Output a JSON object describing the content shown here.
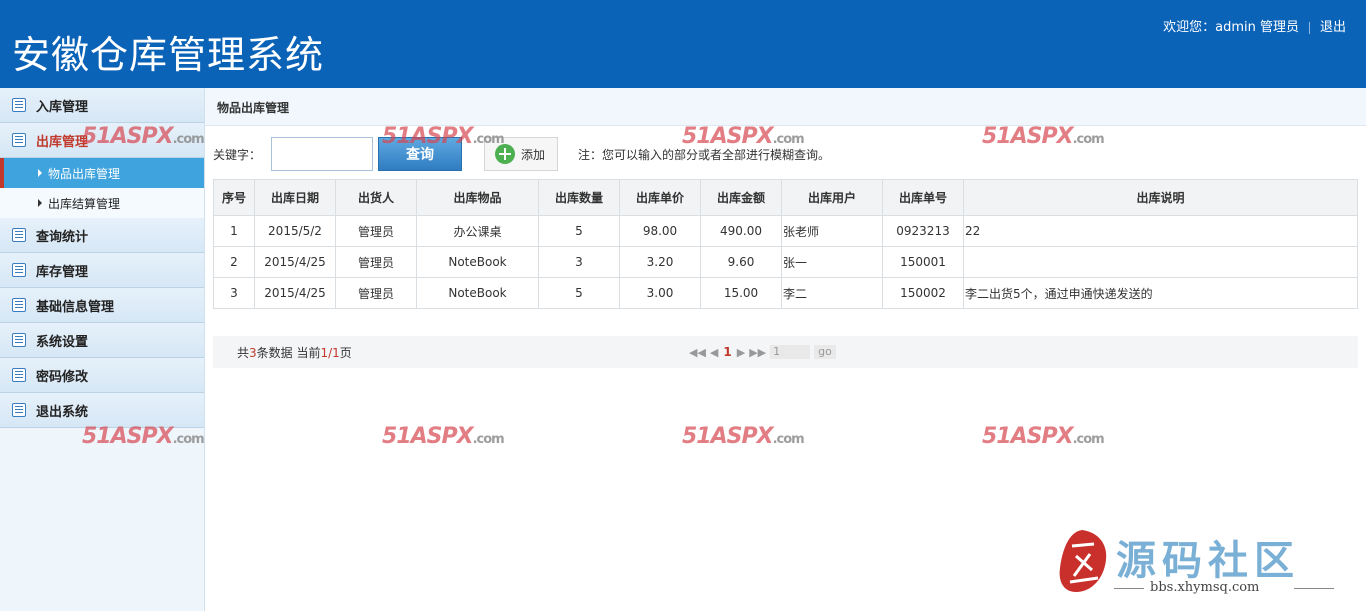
{
  "header": {
    "title": "安徽仓库管理系统",
    "welcome": "欢迎您：admin 管理员",
    "logout": "退出"
  },
  "sidebar": {
    "items": [
      {
        "label": "入库管理"
      },
      {
        "label": "出库管理"
      },
      {
        "label": "查询统计"
      },
      {
        "label": "库存管理"
      },
      {
        "label": "基础信息管理"
      },
      {
        "label": "系统设置"
      },
      {
        "label": "密码修改"
      },
      {
        "label": "退出系统"
      }
    ],
    "sub_items": [
      {
        "label": "物品出库管理"
      },
      {
        "label": "出库结算管理"
      }
    ]
  },
  "main": {
    "breadcrumb": "物品出库管理",
    "search": {
      "label": "关键字：",
      "value": "",
      "query_button": "查询",
      "add_button": "添加",
      "note": "注：您可以输入的部分或者全部进行模糊查询。"
    },
    "table": {
      "headers": [
        "序号",
        "出库日期",
        "出货人",
        "出库物品",
        "出库数量",
        "出库单价",
        "出库金额",
        "出库用户",
        "出库单号",
        "出库说明"
      ],
      "rows": [
        [
          "1",
          "2015/5/2",
          "管理员",
          "办公课桌",
          "5",
          "98.00",
          "490.00",
          "张老师",
          "0923213",
          "22"
        ],
        [
          "2",
          "2015/4/25",
          "管理员",
          "NoteBook",
          "3",
          "3.20",
          "9.60",
          "张一",
          "150001",
          ""
        ],
        [
          "3",
          "2015/4/25",
          "管理员",
          "NoteBook",
          "5",
          "3.00",
          "15.00",
          "李二",
          "150002",
          "李二出货5个，通过申通快递发送的"
        ]
      ]
    },
    "pager": {
      "prefix": "共",
      "total": "3",
      "middle": "条数据 当前",
      "current": "1/1",
      "suffix": "页",
      "first": "◀◀",
      "prev": "◀",
      "page": "1",
      "next": "▶",
      "last": "▶▶",
      "page_input": "1",
      "go": "go"
    }
  },
  "watermark": {
    "brand": "51ASPX",
    "suffix": ".com"
  },
  "site_brand": {
    "name": "源码社区",
    "url": "bbs.xhymsq.com"
  },
  "colors": {
    "header_bg": "#0b63b8",
    "active_sub_bg": "#3fa3dd",
    "accent_red": "#c0392b"
  }
}
